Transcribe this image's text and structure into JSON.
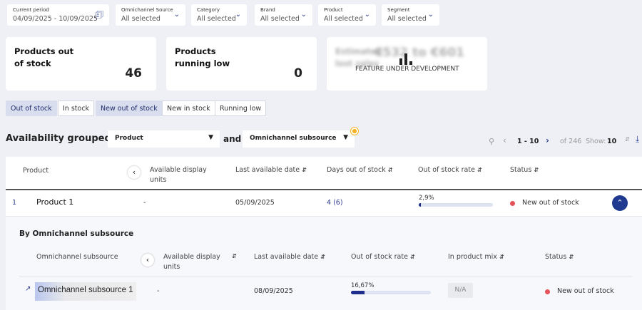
{
  "filters": [
    {
      "label": "Current period",
      "value": "04/09/2025 - 10/09/2025"
    },
    {
      "label": "Omnichannel Source",
      "value": "All selected"
    },
    {
      "label": "Category",
      "value": "All selected"
    },
    {
      "label": "Brand",
      "value": "All selected"
    },
    {
      "label": "Product",
      "value": "All selected"
    },
    {
      "label": "Segment",
      "value": "All selected"
    }
  ],
  "cards": [
    {
      "title_l1": "Products out",
      "title_l2": "of stock",
      "value": "46"
    },
    {
      "title_l1": "Products",
      "title_l2": "running low",
      "value": "0"
    },
    {
      "title_l1": "Estimated",
      "title_l2": "lost sales",
      "value": "€532 to €601",
      "overlay": "FEATURE UNDER DEVELOPMENT"
    }
  ],
  "tabs": [
    "Out of stock",
    "In stock",
    "New out of stock",
    "New in stock",
    "Running low"
  ],
  "grouping": {
    "label": "Availability grouped by",
    "first": "Product",
    "and": "and",
    "second": "Omnichannel subsource"
  },
  "pagination": {
    "range": "1 - 10",
    "of": "of 246",
    "show_label": "Show:",
    "show_value": "10"
  },
  "table": {
    "headers": [
      "Product",
      "Available display units",
      "Last available date",
      "Days out of stock",
      "Out of stock rate",
      "Status"
    ],
    "row": {
      "index": "1",
      "product": "Product 1",
      "units": "-",
      "date": "05/09/2025",
      "days": "4 (6)",
      "rate": "2,9%",
      "rate_value": 2.9,
      "status": "New out of stock"
    }
  },
  "sub": {
    "title": "By Omnichannel subsource",
    "headers": [
      "Omnichannel subsource",
      "Available display units",
      "Last available date",
      "Out of stock rate",
      "In product mix",
      "Status"
    ],
    "row": {
      "name": "Omnichannel subsource 1",
      "units": "-",
      "date": "08/09/2025",
      "rate": "16,67%",
      "rate_value": 16.67,
      "mix": "N/A",
      "status": "New out of stock"
    }
  }
}
